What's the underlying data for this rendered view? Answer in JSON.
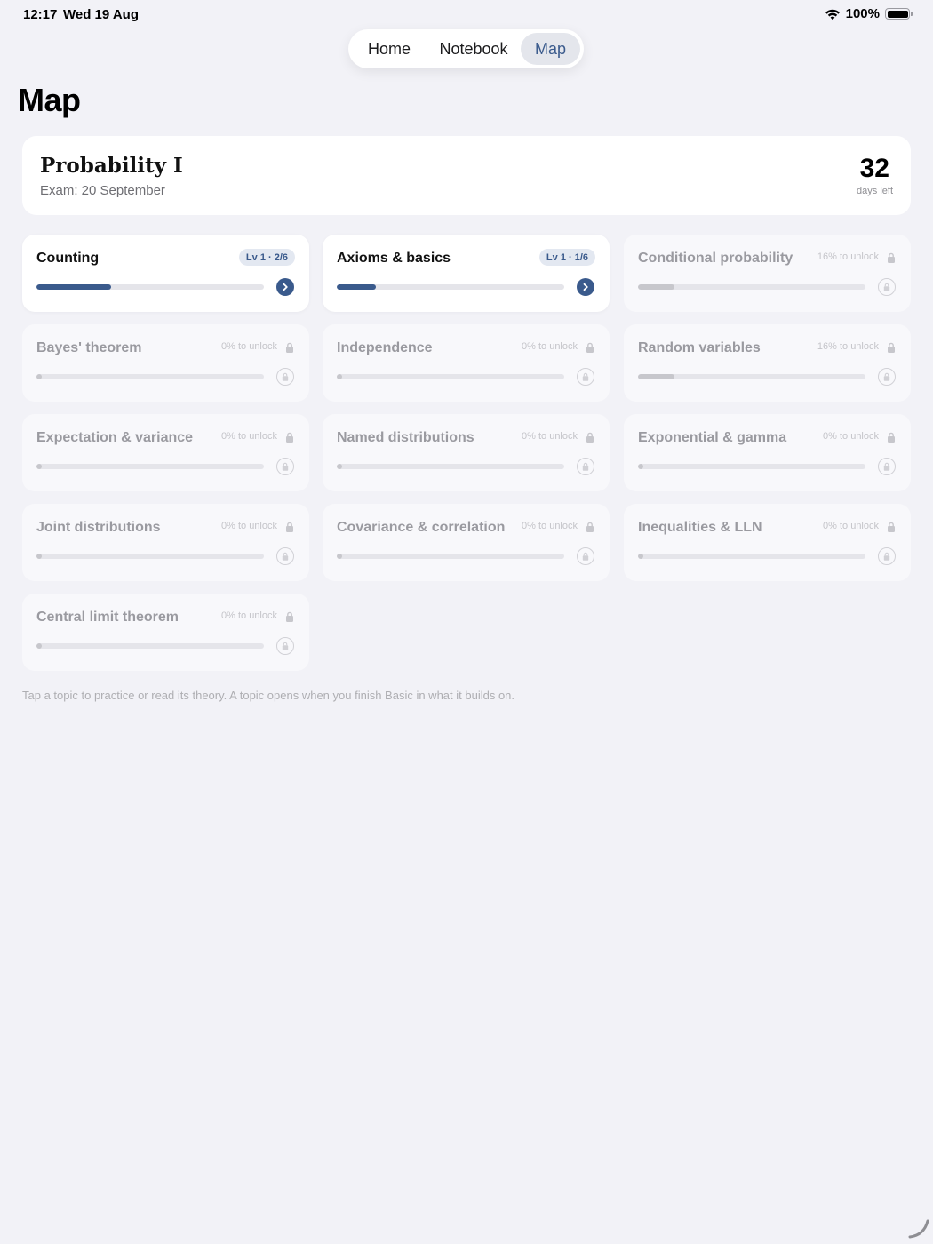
{
  "status_bar": {
    "time": "12:17",
    "date": "Wed 19 Aug",
    "battery": "100%",
    "icons": [
      "wifi-icon",
      "battery-icon"
    ]
  },
  "nav": {
    "items": [
      {
        "label": "Home",
        "selected": false
      },
      {
        "label": "Notebook",
        "selected": false
      },
      {
        "label": "Map",
        "selected": true
      }
    ]
  },
  "page": {
    "title": "Map"
  },
  "course": {
    "name": "Probability I",
    "exam": "Exam: 20 September",
    "days_left": "32",
    "days_left_label": "days left"
  },
  "topics": [
    {
      "name": "Counting",
      "status": "unlocked",
      "badge": "Lv 1 · 2/6",
      "progress": 0.33
    },
    {
      "name": "Axioms & basics",
      "status": "unlocked",
      "badge": "Lv 1 · 1/6",
      "progress": 0.17
    },
    {
      "name": "Conditional probability",
      "status": "locked",
      "unlock": "16% to unlock",
      "progress": 0.16
    },
    {
      "name": "Bayes' theorem",
      "status": "locked",
      "unlock": "0% to unlock",
      "progress": 0
    },
    {
      "name": "Independence",
      "status": "locked",
      "unlock": "0% to unlock",
      "progress": 0
    },
    {
      "name": "Random variables",
      "status": "locked",
      "unlock": "16% to unlock",
      "progress": 0.16
    },
    {
      "name": "Expectation & variance",
      "status": "locked",
      "unlock": "0% to unlock",
      "progress": 0
    },
    {
      "name": "Named distributions",
      "status": "locked",
      "unlock": "0% to unlock",
      "progress": 0
    },
    {
      "name": "Exponential & gamma",
      "status": "locked",
      "unlock": "0% to unlock",
      "progress": 0
    },
    {
      "name": "Joint distributions",
      "status": "locked",
      "unlock": "0% to unlock",
      "progress": 0
    },
    {
      "name": "Covariance & correlation",
      "status": "locked",
      "unlock": "0% to unlock",
      "progress": 0
    },
    {
      "name": "Inequalities & LLN",
      "status": "locked",
      "unlock": "0% to unlock",
      "progress": 0
    },
    {
      "name": "Central limit theorem",
      "status": "locked",
      "unlock": "0% to unlock",
      "progress": 0
    }
  ],
  "footnote": "Tap a topic to practice or read its theory. A topic opens when you finish Basic in what it builds on.",
  "colors": {
    "accent": "#3a5a8c",
    "background": "#f2f2f7",
    "locked_text": "#9a9aa0"
  }
}
